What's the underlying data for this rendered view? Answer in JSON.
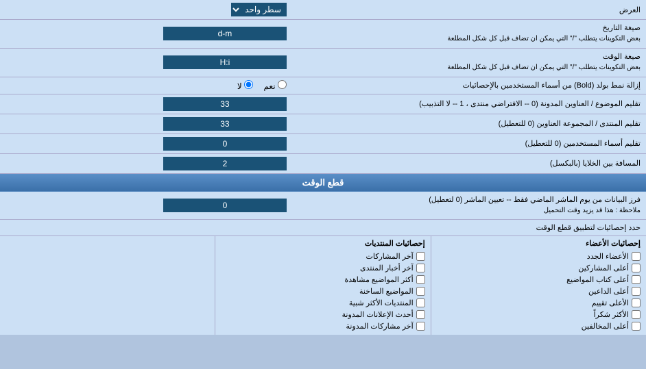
{
  "header": {
    "label_عرض": "العرض",
    "dropdown_label": "سطر واحد"
  },
  "rows": [
    {
      "label": "صيغة التاريخ\nبعض التكوينات يتطلب \"/\" التي يمكن ان تضاف قبل كل شكل المطلعة",
      "value": "d-m"
    },
    {
      "label": "صيغة الوقت\nبعض التكوينات يتطلب \"/\" التي يمكن ان تضاف قبل كل شكل المطلعة",
      "value": "H:i"
    }
  ],
  "radio_row": {
    "label": "إزالة نمط بولد (Bold) من أسماء المستخدمين بالإحصائيات",
    "option_yes": "نعم",
    "option_no": "لا",
    "selected": "no"
  },
  "num_rows": [
    {
      "label": "تقليم الموضوع / العناوين المدونة (0 -- الافتراضي منتدى ، 1 -- لا التذبيب)",
      "value": "33"
    },
    {
      "label": "تقليم المنتدى / المجموعة العناوين (0 للتعطيل)",
      "value": "33"
    },
    {
      "label": "تقليم أسماء المستخدمين (0 للتعطيل)",
      "value": "0"
    },
    {
      "label": "المسافة بين الخلايا (بالبكسل)",
      "value": "2"
    }
  ],
  "section_cutoff": {
    "title": "قطع الوقت"
  },
  "cutoff_row": {
    "label": "فرز البيانات من يوم الماشر الماضي فقط -- تعيين الماشر (0 لتعطيل)\nملاحظة : هذا قد يزيد وقت التحميل",
    "value": "0"
  },
  "stats_header": {
    "label": "حدد إحصائيات لتطبيق قطع الوقت"
  },
  "col1_title": "إحصائيات الأعضاء",
  "col2_title": "إحصائيات المنتديات",
  "col1_items": [
    "الأعضاء الجدد",
    "أعلى المشاركين",
    "أعلى كتاب المواضيع",
    "أعلى الداعين",
    "الأعلى تقييم",
    "الأكثر شكراً",
    "أعلى المخالفين"
  ],
  "col2_items": [
    "آخر المشاركات",
    "آخر أخبار المنتدى",
    "أكثر المواضيع مشاهدة",
    "المواضيع الساخنة",
    "المنتديات الأكثر شبية",
    "أحدث الإعلانات المدونة",
    "آخر مشاركات المدونة"
  ],
  "checkbox_states": {
    "col1": [
      false,
      false,
      false,
      false,
      false,
      false,
      false
    ],
    "col2": [
      false,
      false,
      false,
      false,
      false,
      false,
      false
    ]
  }
}
